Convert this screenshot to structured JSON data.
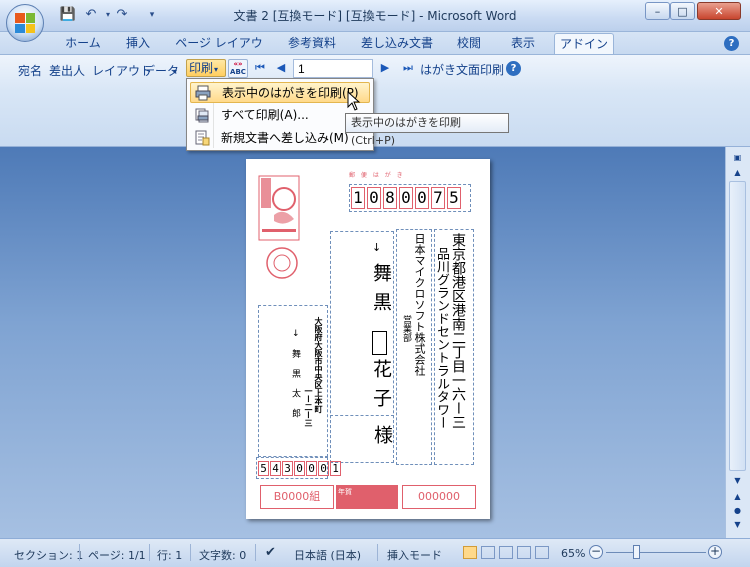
{
  "window": {
    "title": "文書 2 [互換モード] [互換モード] - Microsoft Word",
    "controls": {
      "minimize": "–",
      "maximize": "□",
      "close": "✕"
    }
  },
  "quick_access": {
    "save_icon": "💾",
    "undo_icon": "↶",
    "redo_icon": "↷",
    "more_icon": "▾"
  },
  "tabs": [
    "ホーム",
    "挿入",
    "ページ レイアウト",
    "参考資料",
    "差し込み文書",
    "校閲",
    "表示",
    "アドイン"
  ],
  "active_tab": "アドイン",
  "ribbon": {
    "recipient": "宛名",
    "sender": "差出人",
    "layout": "レイアウト",
    "data": "データ",
    "print": "印刷",
    "abc_top": "«»",
    "abc_bottom": "ABC",
    "first_icon": "⏮",
    "prev_icon": "◀",
    "record_value": "1",
    "next_icon": "▶",
    "last_icon": "⏭",
    "print_face": "はがき文面印刷",
    "help": "?"
  },
  "print_menu": {
    "items": [
      {
        "label": "表示中のはがきを印刷(P)",
        "icon": "printer-icon"
      },
      {
        "label": "すべて印刷(A)...",
        "icon": "print-all-icon"
      },
      {
        "label": "新規文書へ差し込み(M)",
        "icon": "merge-icon"
      }
    ],
    "highlighted_index": 0
  },
  "tooltip": "表示中のはがきを印刷 (Ctrl+P)",
  "postcard": {
    "header": "郵 便 は が き",
    "postal_code": [
      "1",
      "0",
      "8",
      "0",
      "0",
      "7",
      "5"
    ],
    "address_line1": "東京都港区港南二丁目一六ー三",
    "address_line2": "品川グランドセントラルタワー",
    "company": "日本マイクロソフト株式会社",
    "department": "営業部",
    "name_surname": "舞黒",
    "name_given": "花子",
    "honorific": "様",
    "sender_address": "大阪府大阪市中央区上本町",
    "sender_address_num": "一ー二ー三",
    "sender_name": "舞 黒 太 郎",
    "sender_postal": [
      "5",
      "4",
      "3",
      "0",
      "0",
      "0",
      "1"
    ],
    "lottery_left": "B0000組",
    "lottery_right": "000000",
    "stamp_label": "年賀"
  },
  "statusbar": {
    "section": "セクション: 1",
    "page": "ページ: 1/1",
    "line": "行: 1",
    "chars": "文字数: 0",
    "language": "日本語 (日本)",
    "mode": "挿入モード",
    "zoom": "65%"
  }
}
